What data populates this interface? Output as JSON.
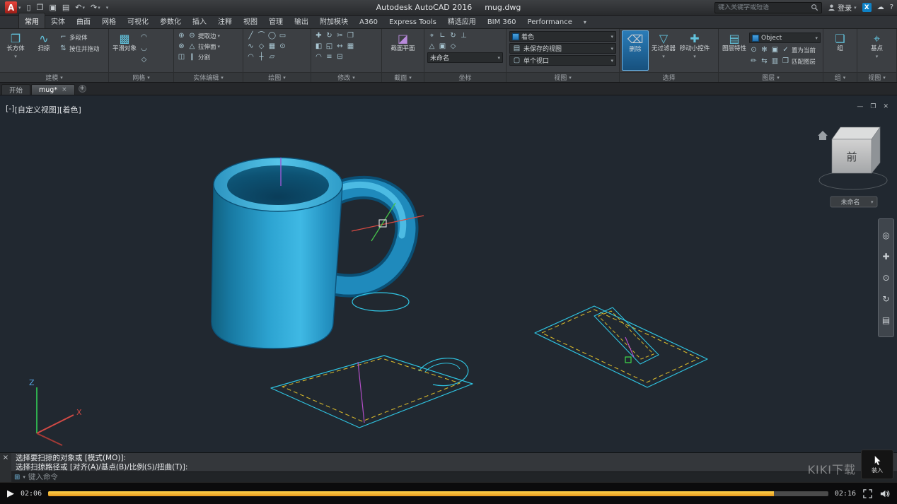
{
  "title_bar": {
    "app_title": "Autodesk AutoCAD 2016",
    "doc_title": "mug.dwg",
    "search_placeholder": "键入关键字或短语",
    "signin_label": "登录"
  },
  "ribbon_tabs": {
    "items": [
      "常用",
      "实体",
      "曲面",
      "网格",
      "可视化",
      "参数化",
      "插入",
      "注释",
      "视图",
      "管理",
      "输出",
      "附加模块",
      "A360",
      "Express Tools",
      "精选应用",
      "BIM 360",
      "Performance"
    ]
  },
  "ribbon": {
    "modeling": {
      "label": "建模",
      "box": "长方体",
      "sweep": "扫掠",
      "polysolid": "多段体",
      "presspull": "按住并拖动"
    },
    "mesh": {
      "label": "网格",
      "smooth_object": "平滑对象"
    },
    "solid_editing": {
      "label": "实体编辑",
      "extract_edges": "提取边",
      "extrude_faces": "拉伸面",
      "separate": "分割"
    },
    "draw": {
      "label": "绘图"
    },
    "modify": {
      "label": "修改"
    },
    "section": {
      "label": "截面",
      "section_plane": "截面平面"
    },
    "coordinates": {
      "label": "坐标",
      "ucs_name": "未命名"
    },
    "view": {
      "label": "视图",
      "visual_style": "着色",
      "named_view": "未保存的视图",
      "viewport_config": "单个视口"
    },
    "selection": {
      "label": "选择",
      "erase": "删除",
      "no_filter": "无过滤器",
      "move_gizmo": "移动小控件"
    },
    "layers": {
      "label": "图层",
      "layer_properties": "图层特性",
      "layer_name": "Object",
      "set_current": "置为当前",
      "match_layer": "匹配图层"
    },
    "groups": {
      "label": "组",
      "group": "组"
    },
    "view_right": {
      "label": "视图",
      "base": "基点"
    }
  },
  "file_tabs": {
    "start": "开始",
    "drawing": "mug*",
    "add": "+"
  },
  "viewport": {
    "controls_minus": "[-]",
    "controls_view": "[自定义视图]",
    "controls_visual": "[着色]",
    "viewcube_face": "前",
    "ucs_tag": "未命名",
    "axis_x": "X",
    "axis_z": "Z"
  },
  "command_line": {
    "line1": "选择要扫掠的对象或 [模式(MO)]:",
    "line2": "选择扫掠路径或 [对齐(A)/基点(B)/比例(S)/扭曲(T)]:",
    "prompt": "键入命令"
  },
  "player": {
    "current_time": "02:06",
    "total_time": "02:16",
    "progress_pct": 93
  },
  "overlay": {
    "watermark": "KIKI下载",
    "badge": "装入"
  }
}
